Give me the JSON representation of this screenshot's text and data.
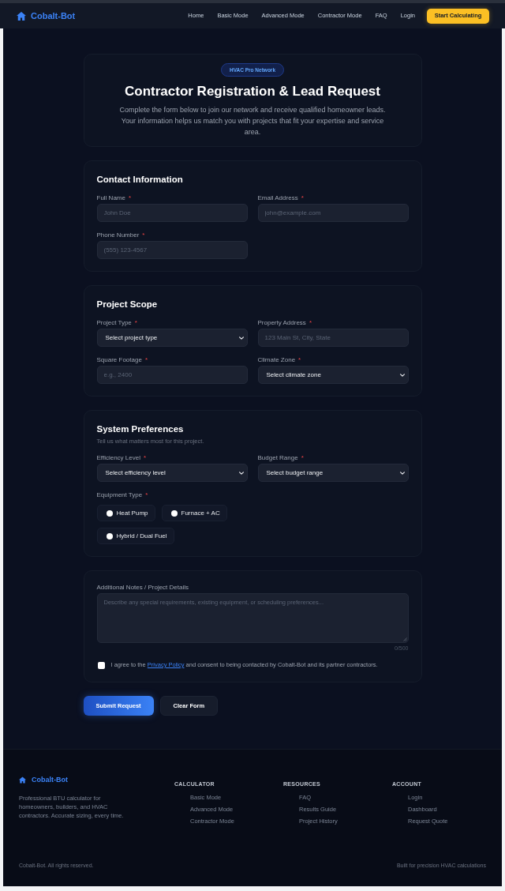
{
  "header": {
    "brand": "Cobalt-Bot",
    "links": [
      "Home",
      "Basic Mode",
      "Advanced Mode",
      "Contractor Mode",
      "FAQ",
      "Login"
    ],
    "cta": "Start Calculating"
  },
  "hero": {
    "badge": "HVAC Pro Network",
    "title": "Contractor Registration & Lead Request",
    "description": "Complete the form below to join our network and receive qualified homeowner leads. Your information helps us match you with projects that fit your expertise and service area."
  },
  "sections": [
    {
      "title": "Contact Information",
      "fields": [
        {
          "kind": "input",
          "label": "Full Name",
          "required_mark": "*",
          "placeholder": "John Doe"
        },
        {
          "kind": "input",
          "label": "Email Address",
          "required_mark": "*",
          "placeholder": "john@example.com"
        },
        {
          "kind": "input",
          "label": "Phone Number",
          "required_mark": "*",
          "placeholder": "(555) 123-4567"
        }
      ]
    },
    {
      "title": "Project Scope",
      "fields": [
        {
          "kind": "select",
          "label": "Project Type",
          "required_mark": "*",
          "value": "Select project type"
        },
        {
          "kind": "input",
          "label": "Property Address",
          "required_mark": "*",
          "placeholder": "123 Main St, City, State"
        },
        {
          "kind": "input",
          "label": "Square Footage",
          "required_mark": "*",
          "placeholder": "e.g., 2400"
        },
        {
          "kind": "select",
          "label": "Climate Zone",
          "required_mark": "*",
          "value": "Select climate zone"
        }
      ]
    },
    {
      "title": "System Preferences",
      "subtitle": "Tell us what matters most for this project.",
      "fields": [
        {
          "kind": "select",
          "label": "Efficiency Level",
          "required_mark": "*",
          "value": "Select efficiency level"
        },
        {
          "kind": "select",
          "label": "Budget Range",
          "required_mark": "*",
          "value": "Select budget range"
        },
        {
          "kind": "radio_group",
          "label": "Equipment Type",
          "required_mark": "*",
          "options": [
            {
              "label": "Heat Pump",
              "selected": false
            },
            {
              "label": "Furnace + AC",
              "selected": false
            },
            {
              "label": "Hybrid / Dual Fuel",
              "selected": false
            }
          ]
        }
      ]
    },
    {
      "fields": [
        {
          "kind": "textarea",
          "label": "Additional Notes / Project Details",
          "placeholder": "Describe any special requirements, existing equipment, or scheduling preferences...",
          "counter": "0/500"
        }
      ],
      "consent": {
        "checked": false,
        "before": "I agree to the",
        "link": "Privacy Policy",
        "after": "and consent to being contacted by Cobalt-Bot and its partner contractors."
      }
    }
  ],
  "actions": [
    {
      "kind": "primary",
      "label": "Submit Request"
    },
    {
      "kind": "secondary",
      "label": "Clear Form"
    }
  ],
  "footer": {
    "brand": "Cobalt-Bot",
    "description": "Professional BTU calculator for homeowners, builders, and HVAC contractors. Accurate sizing, every time.",
    "columns": [
      {
        "heading": "CALCULATOR",
        "links": [
          "Basic Mode",
          "Advanced Mode",
          "Contractor Mode"
        ]
      },
      {
        "heading": "RESOURCES",
        "links": [
          "FAQ",
          "Results Guide",
          "Project History"
        ]
      },
      {
        "heading": "ACCOUNT",
        "links": [
          "Login",
          "Dashboard",
          "Request Quote"
        ]
      }
    ],
    "copyright": "Cobalt-Bot. All rights reserved.",
    "tagline": "Built for precision HVAC calculations"
  }
}
